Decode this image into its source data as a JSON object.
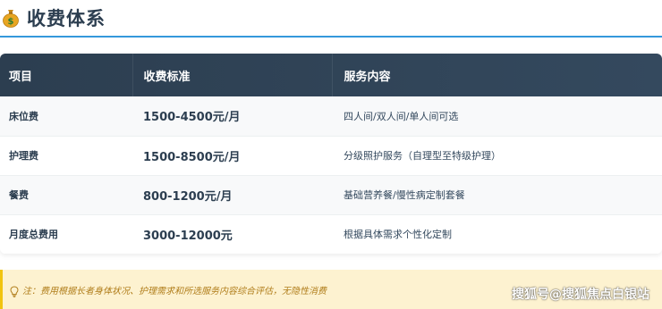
{
  "header": {
    "icon": "money-bag-icon",
    "title": "收费体系"
  },
  "table": {
    "columns": [
      "项目",
      "收费标准",
      "服务内容"
    ],
    "rows": [
      {
        "item": "床位费",
        "price": "1500-4500元/月",
        "desc": "四人间/双人间/单人间可选"
      },
      {
        "item": "护理费",
        "price": "1500-8500元/月",
        "desc": "分级照护服务（自理型至特级护理）"
      },
      {
        "item": "餐费",
        "price": "800-1200元/月",
        "desc": "基础营养餐/慢性病定制套餐"
      },
      {
        "item": "月度总费用",
        "price": "3000-12000元",
        "desc": "根据具体需求个性化定制"
      }
    ]
  },
  "note": {
    "icon": "lightbulb-icon",
    "text": "注：费用根据长者身体状况、护理需求和所选服务内容综合评估，无隐性消费"
  },
  "watermark": "搜狐号@搜狐焦点白银站",
  "colors": {
    "accent": "#3498db",
    "header_bg": "#2c3e50",
    "note_bg": "#fdf2d0",
    "note_text": "#b07d1a"
  }
}
